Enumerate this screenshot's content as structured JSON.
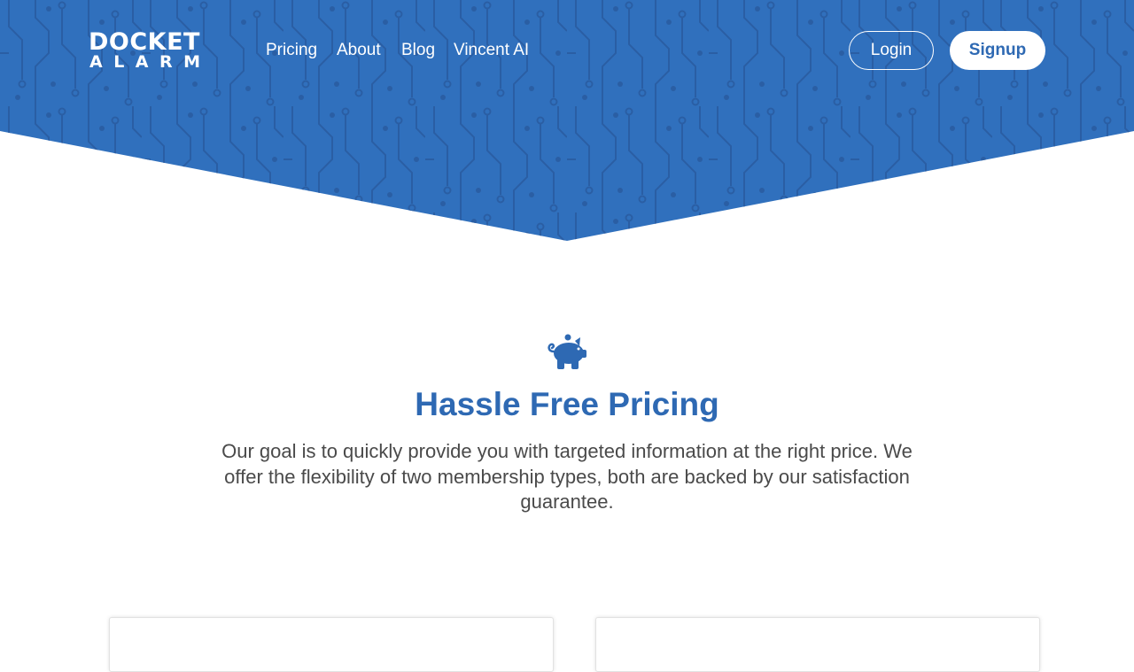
{
  "brand": {
    "logo_line1": "DOCKET",
    "logo_line2": "ALARM",
    "primary_color": "#2e69b3"
  },
  "nav": {
    "links": [
      {
        "label": "Pricing"
      },
      {
        "label": "About"
      },
      {
        "label": "Blog"
      },
      {
        "label": "Vincent AI"
      }
    ],
    "login_label": "Login",
    "signup_label": "Signup"
  },
  "hero": {
    "icon": "piggy-bank-icon",
    "title": "Hassle Free Pricing",
    "description": "Our goal is to quickly provide you with targeted information at the right price. We offer the flexibility of two membership types, both are backed by our satisfaction guarantee."
  },
  "plans": [
    {
      "name": "plan-card-1"
    },
    {
      "name": "plan-card-2"
    }
  ]
}
